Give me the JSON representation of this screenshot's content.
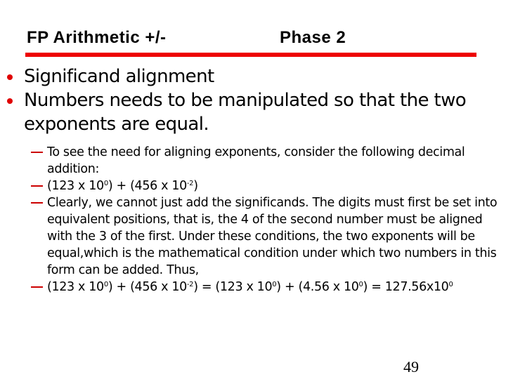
{
  "slide": {
    "title_left": "FP Arithmetic +/-",
    "title_right": "Phase 2",
    "accent_color": "#ee0000",
    "bullets": [
      {
        "text": "Significand alignment"
      },
      {
        "text": "Numbers needs to be manipulated so that the two exponents are equal."
      }
    ],
    "sub_bullets": [
      {
        "text": "To see the need for aligning exponents, consider the following decimal addition:"
      },
      {
        "parts": [
          "(123 x 10",
          "0",
          ") + (456 x 10",
          "-2",
          ")"
        ]
      },
      {
        "text": "Clearly, we cannot just add the significands. The digits must first be set into equivalent positions, that is, the 4 of the second number must be aligned with the 3 of the first. Under these conditions, the two exponents will be equal,which is the mathematical condition under which two numbers in this form can be added. Thus,"
      },
      {
        "parts": [
          "(123 x 10",
          "0",
          ") + (456 x 10",
          "-2",
          ") = (123 x 10",
          "0",
          ") + (4.56 x 10",
          "0",
          ") = 127.56x10",
          "0",
          ""
        ]
      }
    ],
    "page_number": "49"
  }
}
